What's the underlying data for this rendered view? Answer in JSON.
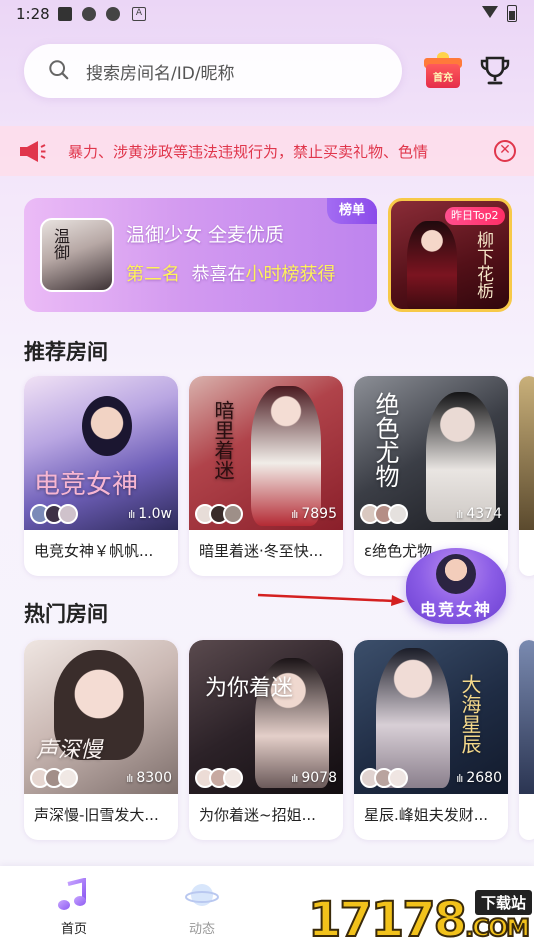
{
  "status_bar": {
    "time": "1:28",
    "notif_letter": "A"
  },
  "search": {
    "placeholder": "搜索房间名/ID/昵称"
  },
  "header": {
    "gift_label": "首充"
  },
  "notice": {
    "text": "暴力、涉黄涉政等违法违规行为，禁止买卖礼物、色情"
  },
  "banner": {
    "tag": "榜单",
    "line1": "温御少女 全麦优质",
    "line2_prefix": "第二名",
    "line2_mid": "恭喜在",
    "line2_highlight": "小时榜获得",
    "avatar_calligraphy": "温御"
  },
  "side_banner": {
    "tag": "昨日Top2",
    "calligraphy": "柳下花栃"
  },
  "sections": {
    "recommended": {
      "title": "推荐房间",
      "rooms": [
        {
          "name": "电竞女神￥帆帆...",
          "count": "1.0w",
          "cover_text": "电竞女神"
        },
        {
          "name": "暗里着迷·冬至快...",
          "count": "7895",
          "cover_text": "暗里着迷"
        },
        {
          "name": "ε绝色尤物...",
          "count": "4374",
          "cover_text": "绝色尤物"
        }
      ]
    },
    "hot": {
      "title": "热门房间",
      "rooms": [
        {
          "name": "声深慢-旧雪发大...",
          "count": "8300",
          "cover_text": "声深慢"
        },
        {
          "name": "为你着迷~招姐...",
          "count": "9078",
          "cover_text": "为你着迷"
        },
        {
          "name": "星辰.峰姐夫发财...",
          "count": "2680",
          "cover_text": "大海星辰"
        }
      ]
    }
  },
  "float_widget": {
    "label": "电竞女神"
  },
  "nav": {
    "home": "首页",
    "feed": "动态"
  },
  "watermark": {
    "digits": "17178",
    "domain": ".COM",
    "badge": "下载站"
  }
}
